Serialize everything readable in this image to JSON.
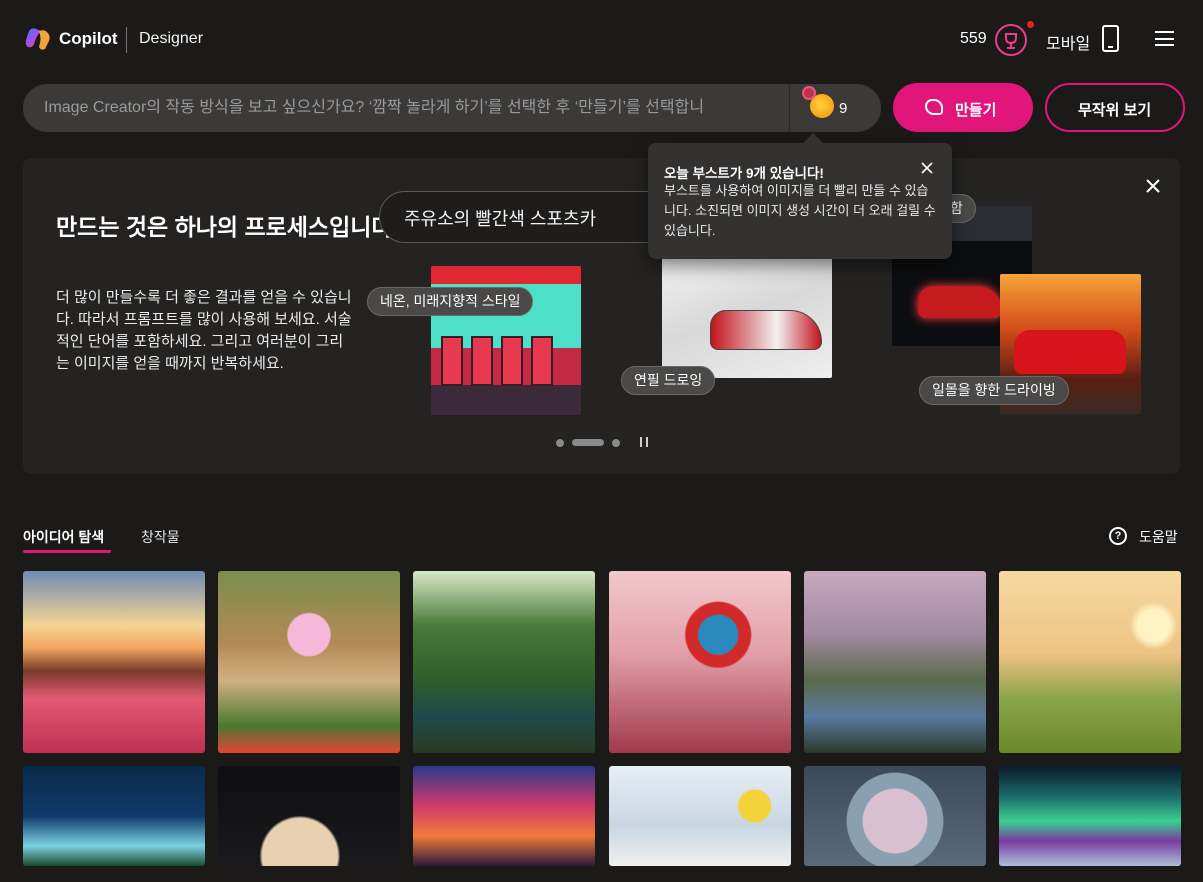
{
  "header": {
    "brand": "Copilot",
    "product": "Designer",
    "points": "559",
    "mobile_label": "모바일"
  },
  "search": {
    "placeholder": "Image Creator의 작동 방식을 보고 싶으신가요? ‘깜짝 놀라게 하기’를 선택한 후 ‘만들기’를 선택합니",
    "value": "",
    "boost_count": "9",
    "create_label": "만들기",
    "random_label": "무작위 보기"
  },
  "tooltip": {
    "title": "오늘 부스트가 9개 있습니다!",
    "body": "부스트를 사용하여 이미지를 더 빨리 만들 수 있습니다. 소진되면 이미지 생성 시간이 더 오래 걸릴 수 있습니다."
  },
  "hero": {
    "title": "만드는 것은 하나의 프로세스입니다.",
    "description": "더 많이 만들수록 더 좋은 결과를 얻을 수 있습니다. 따라서 프롬프트를 많이 사용해 보세요. 서술적인 단어를 포함하세요. 그리고 여러분이 그리는 이미지를 얻을 때까지 반복하세요.",
    "prompt": "주유소의 빨간색 스포츠카",
    "tags": {
      "neon": "네온, 미래지향적 스타일",
      "pencil": "연필 드로잉",
      "sunset": "일몰을 향한 드라이빙",
      "partial": "함"
    }
  },
  "tabs": {
    "explore": "아이디어 탐색",
    "creations": "창작물",
    "help": "도움말"
  },
  "colors": {
    "accent": "#e2157a",
    "background": "#1b1a19",
    "panel": "#242322"
  }
}
